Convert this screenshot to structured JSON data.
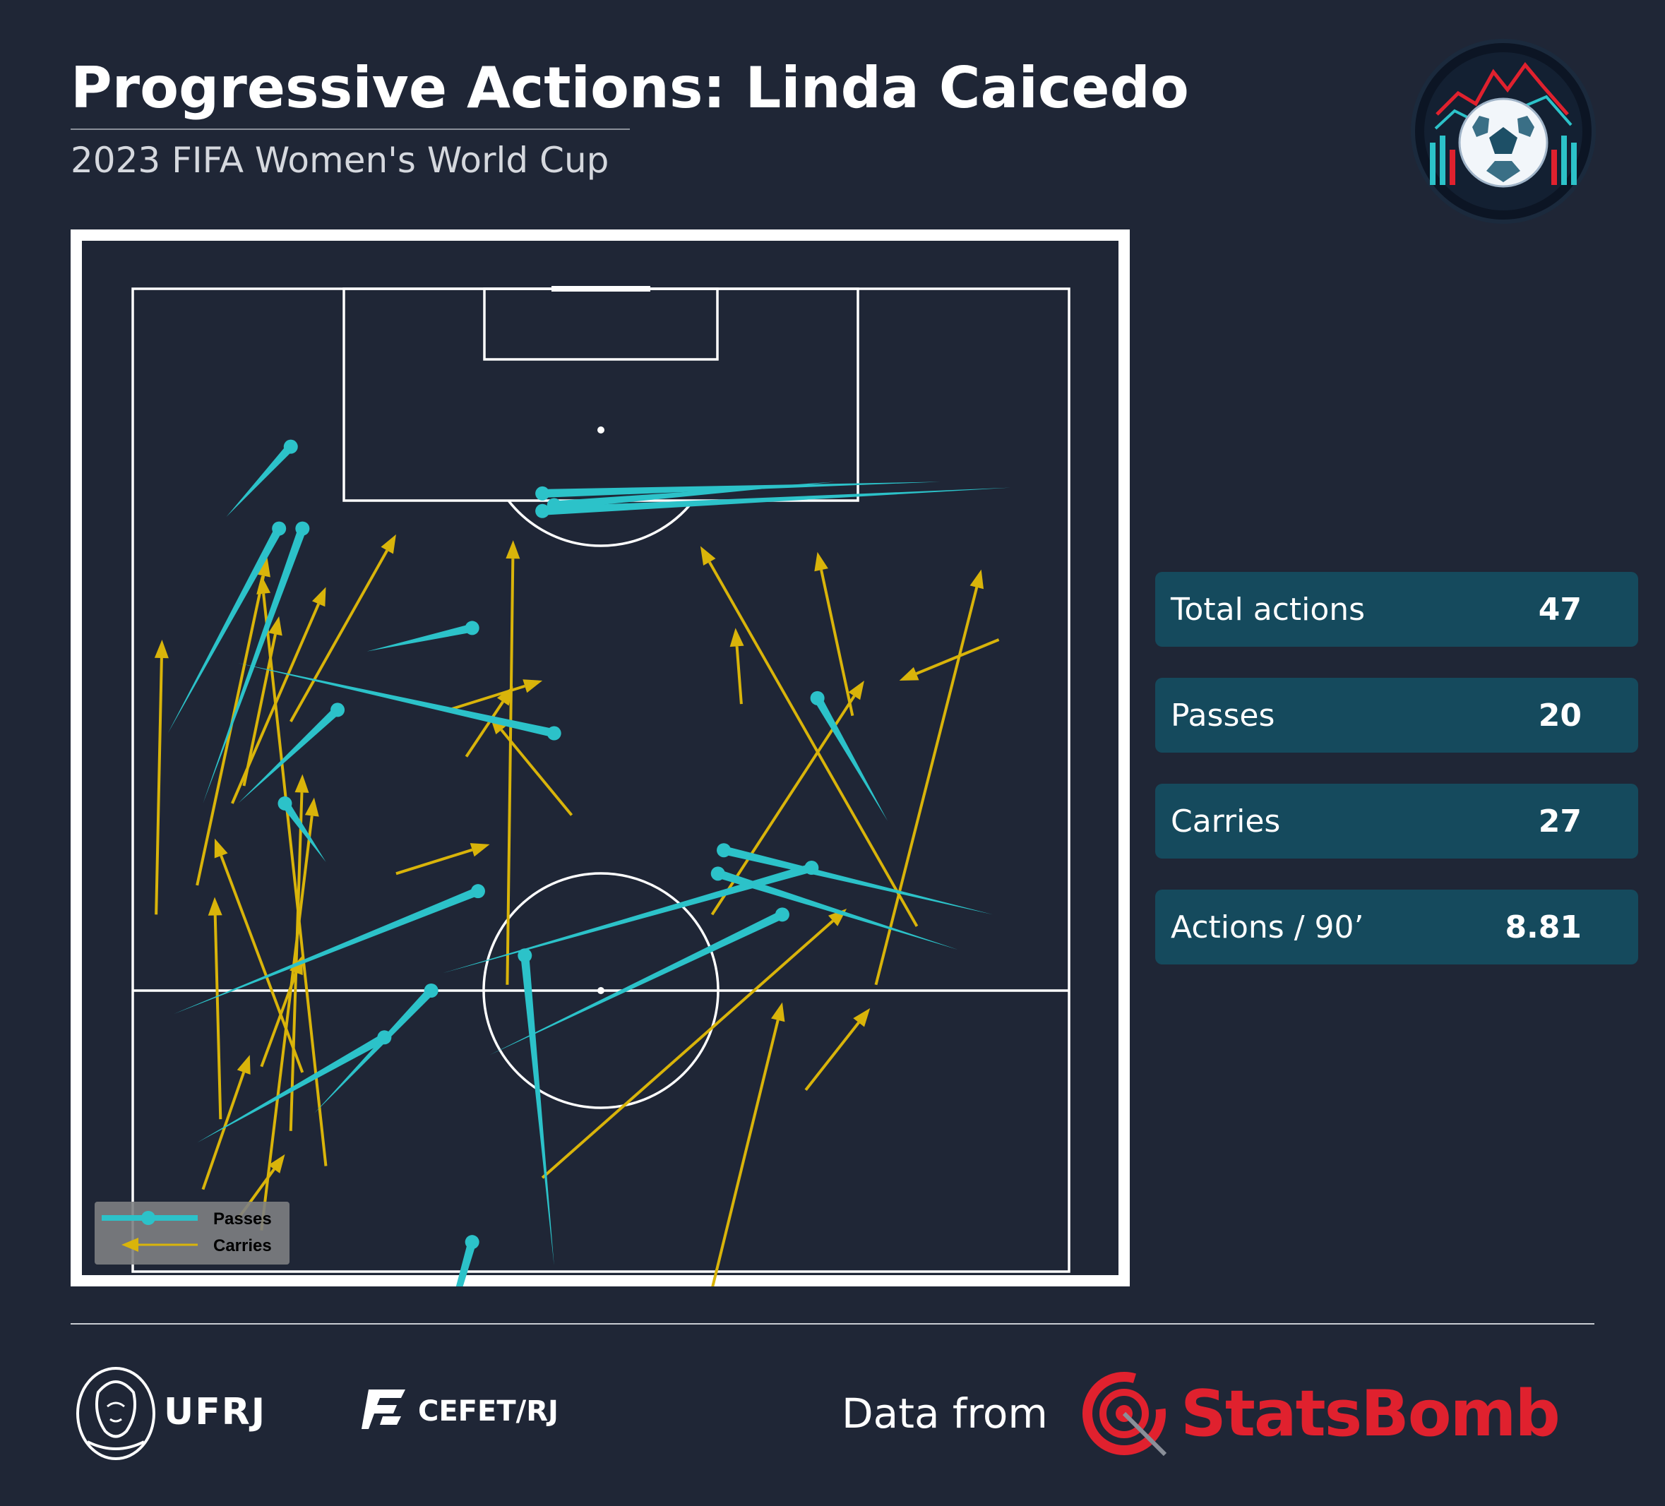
{
  "header": {
    "title": "Progressive Actions: Linda Caicedo",
    "subtitle": "2023 FIFA Women's World Cup"
  },
  "stats": [
    {
      "label": "Total actions",
      "value": "47"
    },
    {
      "label": "Passes",
      "value": "20"
    },
    {
      "label": "Carries",
      "value": "27"
    },
    {
      "label": "Actions / 90’",
      "value": "8.81"
    }
  ],
  "footer": {
    "ufrj": "UFRJ",
    "cefet": "CEFET/RJ",
    "data_from": "Data from",
    "provider": "StatsBomb"
  },
  "colors": {
    "background": "#1f2636",
    "pass": "#2cc2c9",
    "carry": "#d9b40a",
    "stat_box": "#154a5d",
    "statsbomb": "#e0212e"
  },
  "chart_data": {
    "type": "scatter",
    "pitch": {
      "length": 120,
      "width": 80,
      "orientation": "vertical",
      "view": "attacking half plus area beyond halfway",
      "x_visible": [
        36,
        120
      ]
    },
    "legend": {
      "position": "bottom-left",
      "entries": [
        "Passes",
        "Carries"
      ]
    },
    "series": [
      {
        "name": "Passes",
        "actions": [
          {
            "x": [
              106.5,
              100.5
            ],
            "y": [
              13.5,
              8.0
            ]
          },
          {
            "x": [
              99.5,
              82.0
            ],
            "y": [
              12.5,
              3.0
            ]
          },
          {
            "x": [
              99.5,
              76.0
            ],
            "y": [
              14.5,
              6.0
            ]
          },
          {
            "x": [
              101.0,
              103.0
            ],
            "y": [
              35.0,
              75.0
            ]
          },
          {
            "x": [
              101.5,
              103.5
            ],
            "y": [
              36.0,
              60.0
            ]
          },
          {
            "x": [
              102.5,
              103.5
            ],
            "y": [
              35.0,
              69.0
            ]
          },
          {
            "x": [
              91.0,
              89.0
            ],
            "y": [
              29.0,
              20.0
            ]
          },
          {
            "x": [
              84.0,
              76.0
            ],
            "y": [
              17.5,
              9.0
            ]
          },
          {
            "x": [
              82.0,
              88.0
            ],
            "y": [
              36.0,
              9.0
            ]
          },
          {
            "x": [
              85.0,
              74.5
            ],
            "y": [
              58.5,
              64.5
            ]
          },
          {
            "x": [
              76.0,
              71.0
            ],
            "y": [
              13.0,
              16.5
            ]
          },
          {
            "x": [
              70.5,
              61.5
            ],
            "y": [
              58.0,
              26.5
            ]
          },
          {
            "x": [
              72.0,
              66.5
            ],
            "y": [
              50.5,
              73.5
            ]
          },
          {
            "x": [
              70.0,
              63.5
            ],
            "y": [
              50.0,
              70.5
            ]
          },
          {
            "x": [
              68.5,
              58.0
            ],
            "y": [
              29.5,
              3.5
            ]
          },
          {
            "x": [
              66.5,
              54.5
            ],
            "y": [
              55.5,
              30.5
            ]
          },
          {
            "x": [
              63.0,
              36.5
            ],
            "y": [
              33.5,
              36.0
            ]
          },
          {
            "x": [
              60.0,
              49.5
            ],
            "y": [
              25.5,
              15.5
            ]
          },
          {
            "x": [
              56.0,
              47.0
            ],
            "y": [
              21.5,
              5.5
            ]
          },
          {
            "x": [
              38.5,
              21.0
            ],
            "y": [
              29.0,
              24.0
            ]
          }
        ]
      },
      {
        "name": "Carries",
        "actions": [
          {
            "x": [
              83.5,
              97.5
            ],
            "y": [
              61.5,
              58.5
            ]
          },
          {
            "x": [
              65.5,
              98.0
            ],
            "y": [
              67.0,
              48.5
            ]
          },
          {
            "x": [
              60.5,
              96.0
            ],
            "y": [
              63.5,
              72.5
            ]
          },
          {
            "x": [
              66.5,
              86.5
            ],
            "y": [
              49.5,
              62.5
            ]
          },
          {
            "x": [
              44.0,
              67.0
            ],
            "y": [
              35.0,
              61.0
            ]
          },
          {
            "x": [
              34.5,
              59.0
            ],
            "y": [
              49.5,
              55.5
            ]
          },
          {
            "x": [
              60.5,
              98.5
            ],
            "y": [
              32.0,
              32.5
            ]
          },
          {
            "x": [
              53.0,
              73.0
            ],
            "y": [
              14.5,
              7.0
            ]
          },
          {
            "x": [
              66.5,
              90.0
            ],
            "y": [
              2.0,
              2.5
            ]
          },
          {
            "x": [
              90.0,
              86.5
            ],
            "y": [
              74.0,
              65.5
            ]
          },
          {
            "x": [
              84.5,
              91.0
            ],
            "y": [
              52.0,
              51.5
            ]
          },
          {
            "x": [
              80.0,
              86.0
            ],
            "y": [
              28.5,
              32.5
            ]
          },
          {
            "x": [
              75.0,
              83.5
            ],
            "y": [
              37.5,
              30.5
            ]
          },
          {
            "x": [
              70.0,
              72.5
            ],
            "y": [
              22.5,
              30.5
            ]
          },
          {
            "x": [
              51.5,
              58.5
            ],
            "y": [
              57.5,
              63.0
            ]
          },
          {
            "x": [
              84.0,
              86.5
            ],
            "y": [
              27.0,
              35.0
            ]
          },
          {
            "x": [
              83.0,
              99.0
            ],
            "y": [
              13.5,
              22.5
            ]
          },
          {
            "x": [
              76.0,
              94.5
            ],
            "y": [
              8.5,
              16.5
            ]
          },
          {
            "x": [
              69.0,
              97.0
            ],
            "y": [
              5.5,
              11.5
            ]
          },
          {
            "x": [
              45.0,
              95.5
            ],
            "y": [
              16.5,
              11.0
            ]
          },
          {
            "x": [
              48.0,
              78.5
            ],
            "y": [
              13.5,
              14.5
            ]
          },
          {
            "x": [
              39.5,
              76.5
            ],
            "y": [
              11.0,
              15.5
            ]
          },
          {
            "x": [
              53.5,
              63.0
            ],
            "y": [
              11.0,
              14.5
            ]
          },
          {
            "x": [
              49.0,
              68.0
            ],
            "y": [
              7.5,
              7.0
            ]
          },
          {
            "x": [
              77.5,
              92.0
            ],
            "y": [
              9.5,
              12.5
            ]
          },
          {
            "x": [
              43.0,
              54.5
            ],
            "y": [
              6.0,
              10.0
            ]
          },
          {
            "x": [
              40.5,
              46.0
            ],
            "y": [
              9.0,
              13.0
            ]
          }
        ]
      }
    ]
  }
}
